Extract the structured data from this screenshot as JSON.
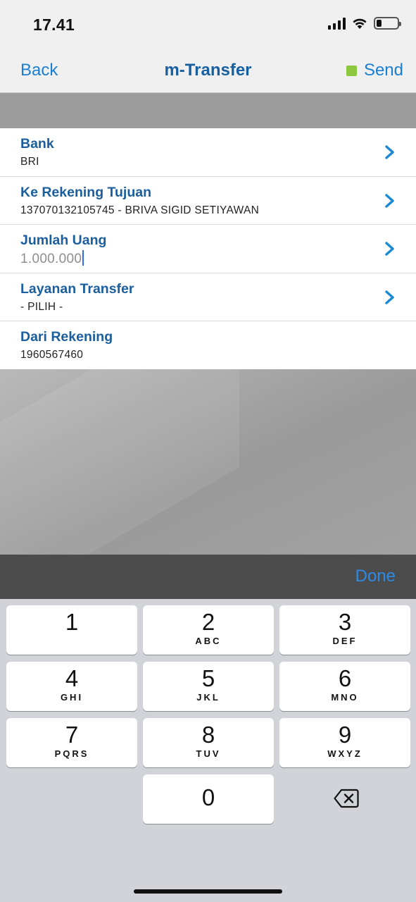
{
  "status": {
    "time": "17.41",
    "battery_level": 0.25
  },
  "nav": {
    "back_label": "Back",
    "title": "m-Transfer",
    "send_label": "Send",
    "send_indicator_color": "#8dc63f"
  },
  "form": {
    "rows": [
      {
        "label": "Bank",
        "value": "BRI",
        "has_chevron": true
      },
      {
        "label": "Ke Rekening Tujuan",
        "value": "137070132105745 - BRIVA SIGID SETIYAWAN",
        "has_chevron": true
      },
      {
        "label": "Jumlah Uang",
        "value": "1.000.000",
        "has_chevron": true
      },
      {
        "label": "Layanan Transfer",
        "value": "- PILIH -",
        "has_chevron": true
      },
      {
        "label": "Dari Rekening",
        "value": "1960567460",
        "has_chevron": false
      }
    ]
  },
  "keyboard": {
    "done_label": "Done",
    "keys": [
      {
        "num": "1",
        "letters": ""
      },
      {
        "num": "2",
        "letters": "ABC"
      },
      {
        "num": "3",
        "letters": "DEF"
      },
      {
        "num": "4",
        "letters": "GHI"
      },
      {
        "num": "5",
        "letters": "JKL"
      },
      {
        "num": "6",
        "letters": "MNO"
      },
      {
        "num": "7",
        "letters": "PQRS"
      },
      {
        "num": "8",
        "letters": "TUV"
      },
      {
        "num": "9",
        "letters": "WXYZ"
      },
      {
        "num": "0",
        "letters": ""
      }
    ],
    "delete_icon": "backspace-icon"
  },
  "colors": {
    "accent": "#1a7fd0",
    "label_blue": "#1a5e9e",
    "chevron": "#1a8ad4"
  }
}
